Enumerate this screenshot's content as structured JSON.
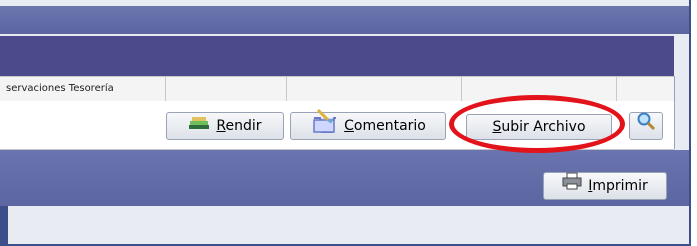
{
  "grid": {
    "headers": [
      "servaciones Tesorería",
      "",
      "",
      "",
      "",
      ""
    ]
  },
  "actions": {
    "rendir_label": "Rendir",
    "comentario_label": "Comentario",
    "subir_label": "Subir Archivo"
  },
  "footer": {
    "imprimir_label": "Imprimir"
  },
  "icons": {
    "rendir": "money-stack-icon",
    "comentario": "comment-brush-icon",
    "search": "magnifier-icon",
    "imprimir": "printer-icon"
  },
  "colors": {
    "highlight": "#e3131b",
    "titlebar": "#5a649f",
    "subheader": "#4d4a8c"
  }
}
